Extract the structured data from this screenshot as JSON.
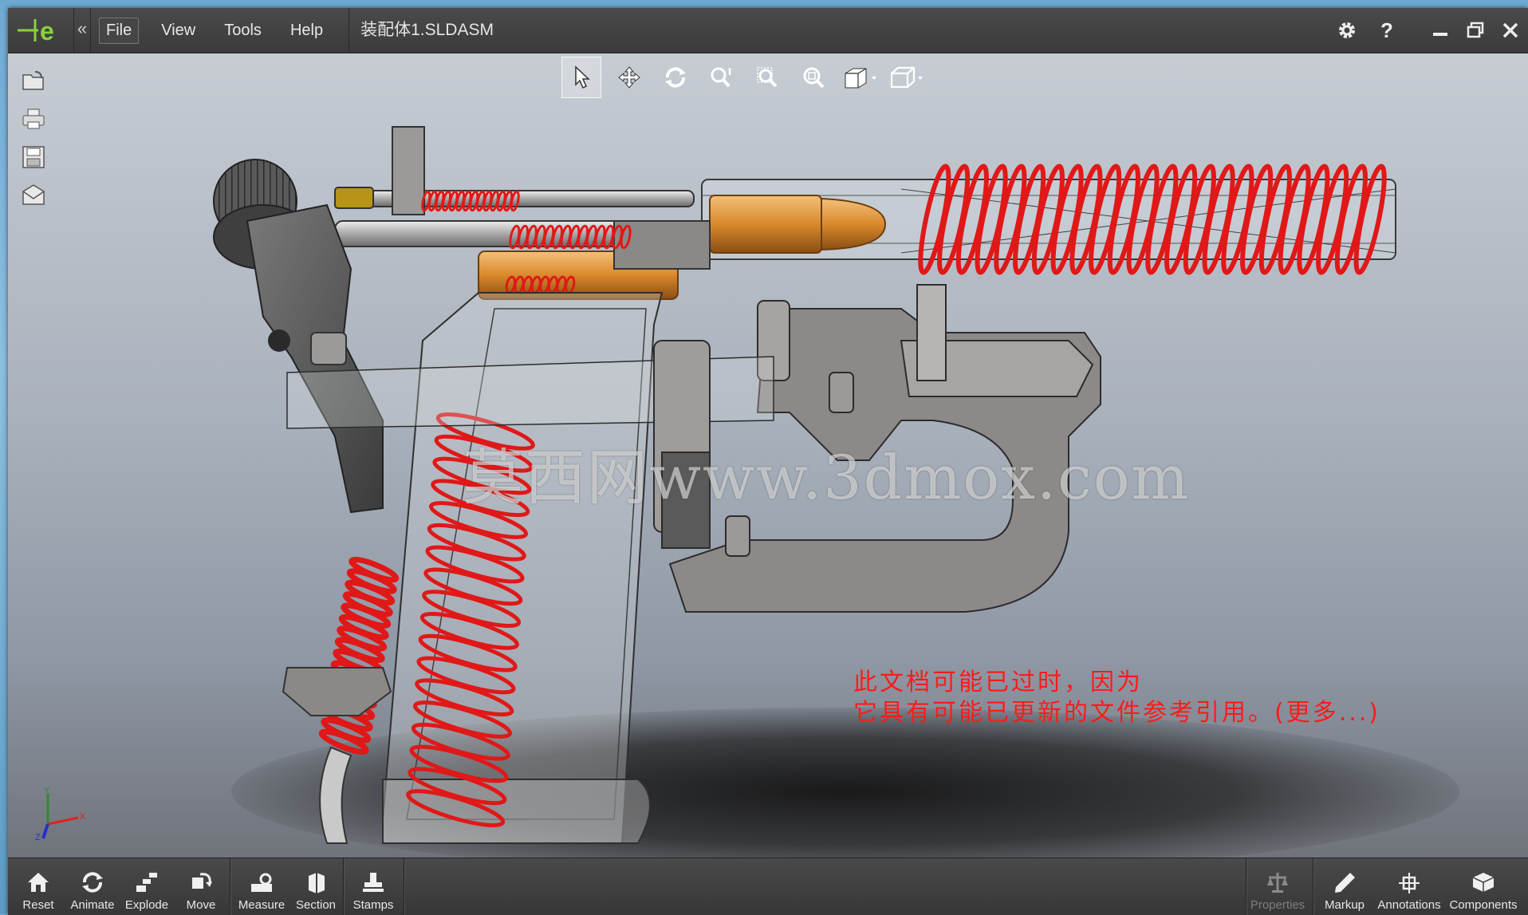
{
  "titlebar": {
    "menu": [
      "File",
      "View",
      "Tools",
      "Help"
    ],
    "document_title": "装配体1.SLDASM"
  },
  "view_toolbar": {
    "icons": [
      "select-icon",
      "pan-icon",
      "rotate-icon",
      "zoom-icon",
      "zoom-to-area-icon",
      "zoom-to-fit-icon",
      "display-style-icon",
      "view-orientation-icon"
    ]
  },
  "left_toolbar": {
    "icons": [
      "open-icon",
      "print-icon",
      "save-icon",
      "email-icon"
    ]
  },
  "viewport": {
    "watermark": "莫西网www.3dmox.com",
    "outdated_line1": "此文档可能已过时，因为",
    "outdated_line2": "它具有可能已更新的文件参考引用。(更多...)",
    "triad": {
      "x": "X",
      "y": "Y",
      "z": "Z"
    },
    "colors": {
      "spring": "#e01818",
      "cartridge": "#d9892b",
      "part": "#8e8a88"
    }
  },
  "bottom_left": [
    {
      "label": "Reset",
      "icon": "home-icon"
    },
    {
      "label": "Animate",
      "icon": "animate-icon"
    },
    {
      "label": "Explode",
      "icon": "explode-icon"
    },
    {
      "label": "Move",
      "icon": "move-icon"
    },
    {
      "label": "Measure",
      "icon": "measure-icon"
    },
    {
      "label": "Section",
      "icon": "section-icon"
    },
    {
      "label": "Stamps",
      "icon": "stamps-icon"
    }
  ],
  "bottom_right": [
    {
      "label": "Properties",
      "icon": "properties-icon"
    },
    {
      "label": "Markup",
      "icon": "markup-icon"
    },
    {
      "label": "Annotations",
      "icon": "annotations-icon"
    },
    {
      "label": "Components",
      "icon": "components-icon"
    }
  ]
}
